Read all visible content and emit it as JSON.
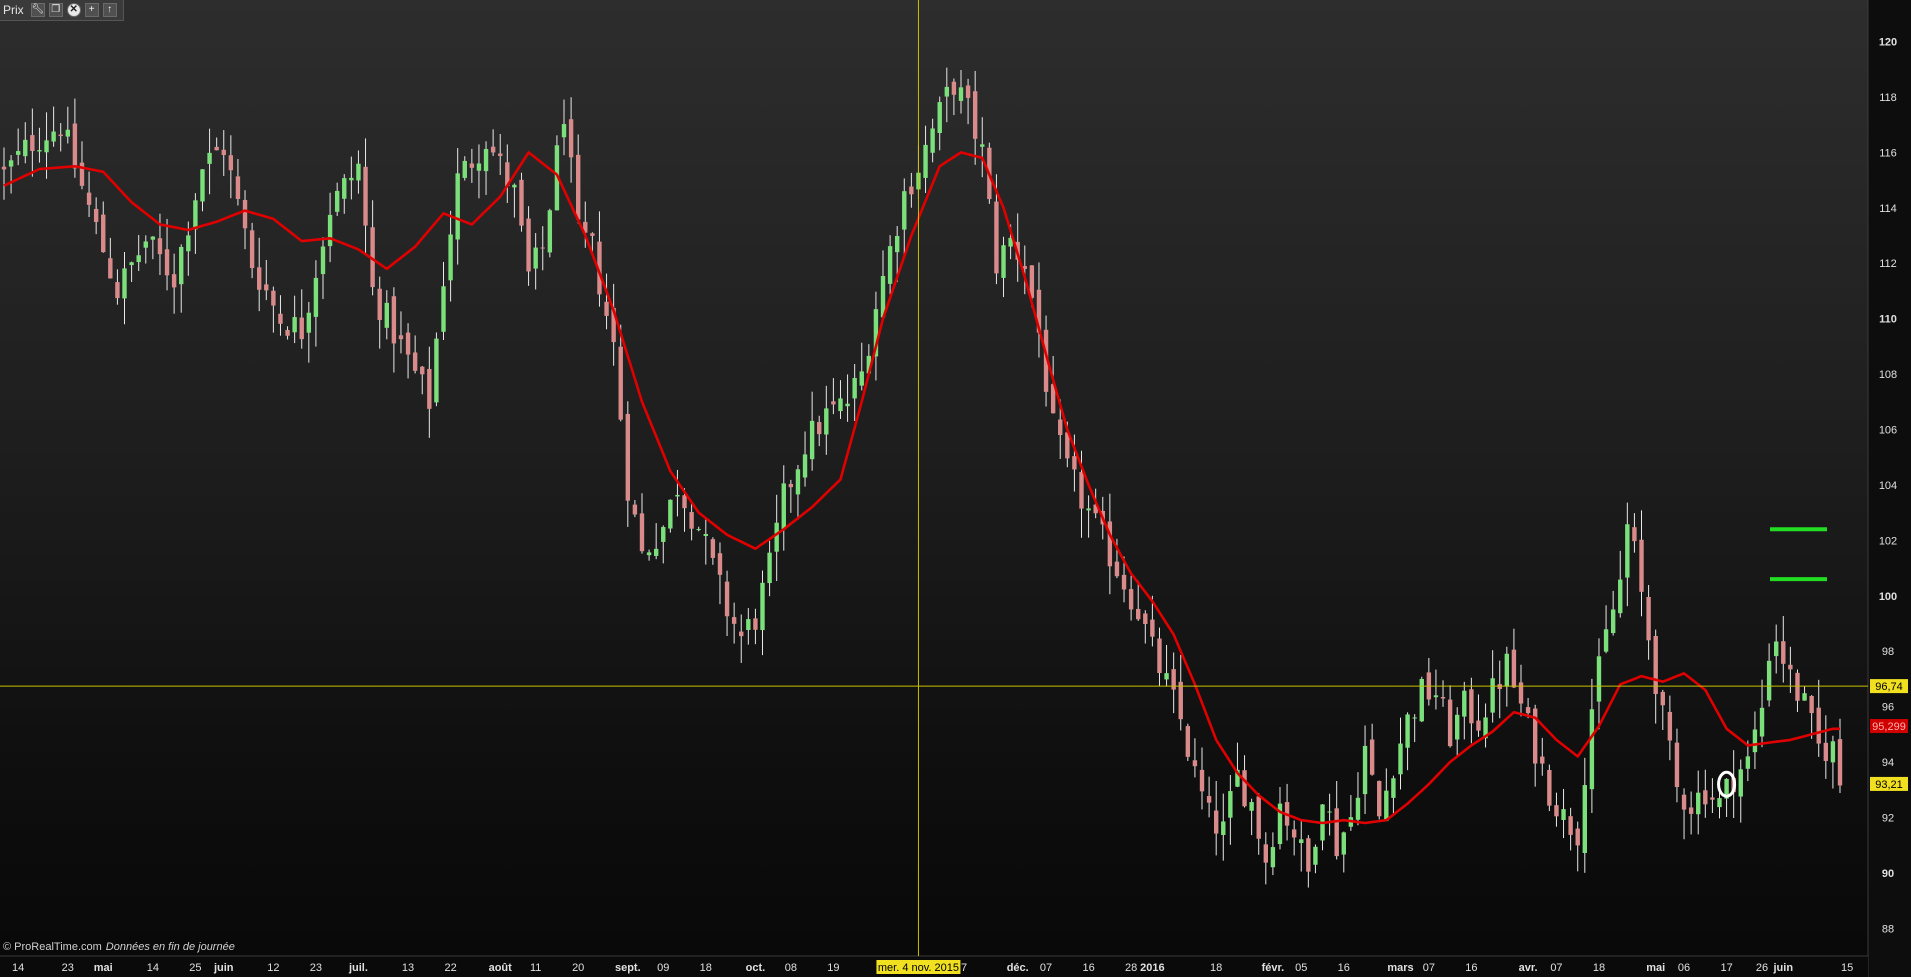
{
  "toolbar": {
    "title": "Prix",
    "buttons": [
      "wrench-icon",
      "window-restore-icon",
      "close-icon",
      "add-icon",
      "collapse-icon"
    ]
  },
  "footer": {
    "copyright": "© ProRealTime.com",
    "note": "Données en fin de journée"
  },
  "crosshair": {
    "date_label": "mer. 4 nov. 2015",
    "price_label": "96,74",
    "price": 96.74
  },
  "price_tags": {
    "ma_label": "95,299",
    "ma_value": 95.299,
    "last_label": "93,21",
    "last_value": 93.21
  },
  "colors": {
    "up_candle": "#7be07b",
    "down_candle": "#d98a8a",
    "moving_average": "#e00000",
    "crosshair": "#c8c000",
    "level_lines": "#22dd22",
    "tag_yellow": "#f0e020",
    "tag_red": "#d00000"
  },
  "chart_data": {
    "type": "candlestick",
    "title": "",
    "xlabel": "",
    "ylabel": "",
    "ylim": [
      87,
      121.5
    ],
    "y_ticks": [
      88,
      90,
      92,
      94,
      96,
      98,
      100,
      102,
      104,
      106,
      108,
      110,
      112,
      114,
      116,
      118,
      120
    ],
    "y_bold_ticks": [
      90,
      100,
      110,
      120
    ],
    "x_tick_labels": [
      {
        "i": 2,
        "label": "14"
      },
      {
        "i": 9,
        "label": "23"
      },
      {
        "i": 14,
        "label": "mai",
        "bold": true
      },
      {
        "i": 21,
        "label": "14"
      },
      {
        "i": 27,
        "label": "25"
      },
      {
        "i": 31,
        "label": "juin",
        "bold": true
      },
      {
        "i": 38,
        "label": "12"
      },
      {
        "i": 44,
        "label": "23"
      },
      {
        "i": 50,
        "label": "juil.",
        "bold": true
      },
      {
        "i": 57,
        "label": "13"
      },
      {
        "i": 63,
        "label": "22"
      },
      {
        "i": 70,
        "label": "août",
        "bold": true
      },
      {
        "i": 75,
        "label": "11"
      },
      {
        "i": 81,
        "label": "20"
      },
      {
        "i": 88,
        "label": "sept.",
        "bold": true
      },
      {
        "i": 93,
        "label": "09"
      },
      {
        "i": 99,
        "label": "18"
      },
      {
        "i": 106,
        "label": "oct.",
        "bold": true
      },
      {
        "i": 111,
        "label": "08"
      },
      {
        "i": 117,
        "label": "19"
      },
      {
        "i": 135,
        "label": "17"
      },
      {
        "i": 143,
        "label": "déc.",
        "bold": true
      },
      {
        "i": 147,
        "label": "07"
      },
      {
        "i": 153,
        "label": "16"
      },
      {
        "i": 159,
        "label": "28"
      },
      {
        "i": 162,
        "label": "2016",
        "bold": true
      },
      {
        "i": 171,
        "label": "18"
      },
      {
        "i": 179,
        "label": "févr.",
        "bold": true
      },
      {
        "i": 183,
        "label": "05"
      },
      {
        "i": 189,
        "label": "16"
      },
      {
        "i": 197,
        "label": "mars",
        "bold": true
      },
      {
        "i": 201,
        "label": "07"
      },
      {
        "i": 207,
        "label": "16"
      },
      {
        "i": 215,
        "label": "avr.",
        "bold": true
      },
      {
        "i": 219,
        "label": "07"
      },
      {
        "i": 225,
        "label": "18"
      },
      {
        "i": 233,
        "label": "mai",
        "bold": true
      },
      {
        "i": 237,
        "label": "06"
      },
      {
        "i": 243,
        "label": "17"
      },
      {
        "i": 248,
        "label": "26"
      },
      {
        "i": 251,
        "label": "juin",
        "bold": true
      },
      {
        "i": 260,
        "label": "15"
      }
    ],
    "level_lines": [
      102.4,
      100.6
    ],
    "ma_anchors": [
      [
        0,
        114.8
      ],
      [
        5,
        115.4
      ],
      [
        10,
        115.5
      ],
      [
        14,
        115.3
      ],
      [
        18,
        114.2
      ],
      [
        22,
        113.4
      ],
      [
        26,
        113.2
      ],
      [
        30,
        113.5
      ],
      [
        34,
        113.9
      ],
      [
        38,
        113.6
      ],
      [
        42,
        112.8
      ],
      [
        46,
        112.9
      ],
      [
        50,
        112.5
      ],
      [
        54,
        111.8
      ],
      [
        58,
        112.6
      ],
      [
        62,
        113.8
      ],
      [
        66,
        113.4
      ],
      [
        70,
        114.4
      ],
      [
        74,
        116.0
      ],
      [
        78,
        115.2
      ],
      [
        82,
        113.0
      ],
      [
        86,
        110.3
      ],
      [
        90,
        107.0
      ],
      [
        94,
        104.5
      ],
      [
        98,
        103.0
      ],
      [
        102,
        102.2
      ],
      [
        106,
        101.7
      ],
      [
        110,
        102.4
      ],
      [
        114,
        103.2
      ],
      [
        118,
        104.2
      ],
      [
        121,
        107.0
      ],
      [
        124,
        110.0
      ],
      [
        128,
        113.0
      ],
      [
        132,
        115.5
      ],
      [
        135,
        116.0
      ],
      [
        138,
        115.8
      ],
      [
        141,
        114.0
      ],
      [
        144,
        111.5
      ],
      [
        147,
        108.7
      ],
      [
        150,
        106.0
      ],
      [
        153,
        104.0
      ],
      [
        156,
        102.2
      ],
      [
        159,
        100.8
      ],
      [
        162,
        99.8
      ],
      [
        165,
        98.6
      ],
      [
        168,
        96.8
      ],
      [
        171,
        94.8
      ],
      [
        174,
        93.6
      ],
      [
        177,
        92.8
      ],
      [
        180,
        92.2
      ],
      [
        183,
        91.9
      ],
      [
        186,
        91.8
      ],
      [
        189,
        91.9
      ],
      [
        192,
        91.8
      ],
      [
        195,
        91.9
      ],
      [
        198,
        92.5
      ],
      [
        201,
        93.2
      ],
      [
        204,
        94.0
      ],
      [
        207,
        94.6
      ],
      [
        210,
        95.1
      ],
      [
        213,
        95.8
      ],
      [
        216,
        95.6
      ],
      [
        219,
        94.8
      ],
      [
        222,
        94.2
      ],
      [
        225,
        95.3
      ],
      [
        228,
        96.8
      ],
      [
        231,
        97.1
      ],
      [
        234,
        96.9
      ],
      [
        237,
        97.2
      ],
      [
        240,
        96.6
      ],
      [
        243,
        95.2
      ],
      [
        246,
        94.6
      ],
      [
        249,
        94.7
      ],
      [
        252,
        94.8
      ],
      [
        255,
        95.0
      ],
      [
        258,
        95.2
      ]
    ],
    "close_anchors": [
      [
        0,
        115.2
      ],
      [
        4,
        116.4
      ],
      [
        8,
        117.0
      ],
      [
        12,
        114.0
      ],
      [
        16,
        111.0
      ],
      [
        20,
        112.8
      ],
      [
        24,
        111.5
      ],
      [
        28,
        115.5
      ],
      [
        31,
        116.2
      ],
      [
        35,
        112.0
      ],
      [
        39,
        110.0
      ],
      [
        42,
        109.6
      ],
      [
        46,
        114.0
      ],
      [
        50,
        115.5
      ],
      [
        52,
        111.0
      ],
      [
        55,
        109.5
      ],
      [
        58,
        108.0
      ],
      [
        60,
        107.0
      ],
      [
        62,
        111.5
      ],
      [
        64,
        115.0
      ],
      [
        68,
        116.5
      ],
      [
        72,
        114.5
      ],
      [
        74,
        111.5
      ],
      [
        76,
        112.5
      ],
      [
        79,
        117.5
      ],
      [
        81,
        113.0
      ],
      [
        83,
        112.5
      ],
      [
        86,
        109.0
      ],
      [
        88,
        104.0
      ],
      [
        90,
        101.5
      ],
      [
        93,
        102.5
      ],
      [
        95,
        104.0
      ],
      [
        98,
        102.5
      ],
      [
        100,
        101.0
      ],
      [
        102,
        99.5
      ],
      [
        104,
        98.5
      ],
      [
        106,
        99.2
      ],
      [
        108,
        101.0
      ],
      [
        110,
        103.5
      ],
      [
        113,
        105.5
      ],
      [
        116,
        106.5
      ],
      [
        119,
        107.0
      ],
      [
        121,
        108.0
      ],
      [
        123,
        110.5
      ],
      [
        125,
        112.5
      ],
      [
        127,
        114.5
      ],
      [
        129,
        115.5
      ],
      [
        131,
        116.8
      ],
      [
        133,
        118.0
      ],
      [
        134,
        118.5
      ],
      [
        136,
        117.5
      ],
      [
        138,
        116.0
      ],
      [
        140,
        112.0
      ],
      [
        142,
        112.8
      ],
      [
        144,
        112.0
      ],
      [
        146,
        109.5
      ],
      [
        148,
        106.0
      ],
      [
        150,
        104.5
      ],
      [
        152,
        103.5
      ],
      [
        154,
        102.5
      ],
      [
        156,
        101.5
      ],
      [
        158,
        100.5
      ],
      [
        160,
        99.5
      ],
      [
        162,
        98.0
      ],
      [
        164,
        96.8
      ],
      [
        166,
        95.5
      ],
      [
        168,
        93.5
      ],
      [
        170,
        92.0
      ],
      [
        172,
        91.5
      ],
      [
        174,
        93.5
      ],
      [
        176,
        92.5
      ],
      [
        178,
        90.5
      ],
      [
        180,
        92.5
      ],
      [
        182,
        91.5
      ],
      [
        184,
        90.0
      ],
      [
        186,
        93.0
      ],
      [
        188,
        91.0
      ],
      [
        190,
        92.0
      ],
      [
        192,
        94.5
      ],
      [
        194,
        92.0
      ],
      [
        196,
        94.0
      ],
      [
        198,
        95.5
      ],
      [
        200,
        96.5
      ],
      [
        202,
        96.5
      ],
      [
        204,
        95.0
      ],
      [
        206,
        96.0
      ],
      [
        208,
        95.5
      ],
      [
        210,
        96.5
      ],
      [
        212,
        97.5
      ],
      [
        214,
        96.0
      ],
      [
        216,
        94.5
      ],
      [
        218,
        93.0
      ],
      [
        220,
        92.0
      ],
      [
        222,
        91.5
      ],
      [
        224,
        96.0
      ],
      [
        226,
        98.5
      ],
      [
        228,
        100.5
      ],
      [
        229,
        102.5
      ],
      [
        230,
        101.5
      ],
      [
        232,
        98.5
      ],
      [
        234,
        95.5
      ],
      [
        236,
        93.0
      ],
      [
        238,
        92.5
      ],
      [
        240,
        93.0
      ],
      [
        242,
        92.5
      ],
      [
        244,
        93.5
      ],
      [
        246,
        94.0
      ],
      [
        248,
        96.0
      ],
      [
        249,
        98.0
      ],
      [
        250,
        98.5
      ],
      [
        252,
        97.0
      ],
      [
        254,
        96.0
      ],
      [
        256,
        94.5
      ],
      [
        258,
        94.5
      ],
      [
        259,
        93.21
      ]
    ],
    "candle_count": 260
  }
}
